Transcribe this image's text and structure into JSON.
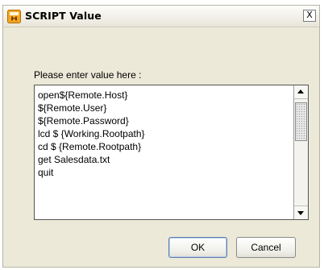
{
  "window": {
    "title": "SCRIPT Value",
    "icon": "app-icon",
    "close_label": "X"
  },
  "form": {
    "prompt": "Please enter value here :",
    "lines": [
      "open${Remote.Host}",
      "${Remote.User}",
      "${Remote.Password}",
      "lcd $ {Working.Rootpath}",
      "cd $ {Remote.Rootpath}",
      "get Salesdata.txt",
      "quit"
    ]
  },
  "buttons": {
    "ok": "OK",
    "cancel": "Cancel"
  },
  "colors": {
    "dialog_background": "#ece9d8",
    "title_icon": "#f5a623"
  }
}
